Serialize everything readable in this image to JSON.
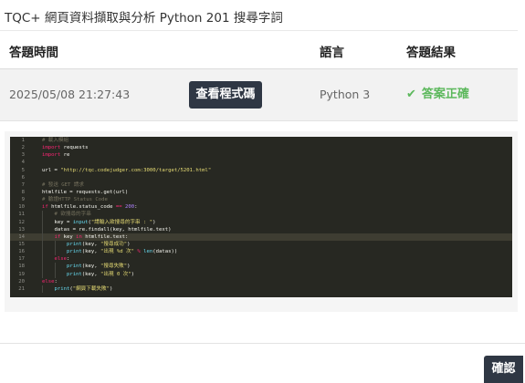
{
  "page": {
    "title": "TQC+ 網頁資料擷取與分析 Python 201 搜尋字詞"
  },
  "table": {
    "headers": [
      "答題時間",
      "語言",
      "答題結果"
    ],
    "row": {
      "time": "2025/05/08 21:27:43",
      "view_button": "查看程式碼",
      "language": "Python 3",
      "result": "答案正確"
    }
  },
  "code": {
    "active_line": 14,
    "lines": [
      [
        {
          "t": "# 載入模組",
          "c": "cm"
        }
      ],
      [
        {
          "t": "import",
          "c": "kw"
        },
        {
          "t": " requests"
        }
      ],
      [
        {
          "t": "import",
          "c": "kw"
        },
        {
          "t": " re"
        }
      ],
      [],
      [
        {
          "t": "url = "
        },
        {
          "t": "\"http://tqc.codejudger.com:3000/target/5201.html\"",
          "c": "st"
        }
      ],
      [],
      [
        {
          "t": "# 發送 GET 請求",
          "c": "cm"
        }
      ],
      [
        {
          "t": "htmlfile = requests.get(url)"
        }
      ],
      [
        {
          "t": "# 驗證HTTP Status Code",
          "c": "cm"
        }
      ],
      [
        {
          "t": "if",
          "c": "kw"
        },
        {
          "t": " htmlfile.status_code "
        },
        {
          "t": "==",
          "c": "kw"
        },
        {
          "t": " "
        },
        {
          "t": "200",
          "c": "nu"
        },
        {
          "t": ":"
        }
      ],
      [
        {
          "t": "    "
        },
        {
          "t": "# 欲搜尋的字串",
          "c": "cm"
        }
      ],
      [
        {
          "t": "    key = "
        },
        {
          "t": "input",
          "c": "bi"
        },
        {
          "t": "("
        },
        {
          "t": "\"請輸入欲搜尋的字串 : \"",
          "c": "st"
        },
        {
          "t": ")"
        }
      ],
      [
        {
          "t": "    datas = re.findall(key, htmlfile.text)"
        }
      ],
      [
        {
          "t": "    "
        },
        {
          "t": "if",
          "c": "kw"
        },
        {
          "t": " key "
        },
        {
          "t": "in",
          "c": "kw"
        },
        {
          "t": " htmlfile.text:"
        }
      ],
      [
        {
          "t": "        "
        },
        {
          "t": "print",
          "c": "bi"
        },
        {
          "t": "(key, "
        },
        {
          "t": "\"搜尋成功\"",
          "c": "st"
        },
        {
          "t": ")"
        }
      ],
      [
        {
          "t": "        "
        },
        {
          "t": "print",
          "c": "bi"
        },
        {
          "t": "(key, "
        },
        {
          "t": "\"出現 %d 次\"",
          "c": "st"
        },
        {
          "t": " "
        },
        {
          "t": "%",
          "c": "kw"
        },
        {
          "t": " "
        },
        {
          "t": "len",
          "c": "bi"
        },
        {
          "t": "(datas))"
        }
      ],
      [
        {
          "t": "    "
        },
        {
          "t": "else",
          "c": "kw"
        },
        {
          "t": ":"
        }
      ],
      [
        {
          "t": "        "
        },
        {
          "t": "print",
          "c": "bi"
        },
        {
          "t": "(key, "
        },
        {
          "t": "\"搜尋失敗\"",
          "c": "st"
        },
        {
          "t": ")"
        }
      ],
      [
        {
          "t": "        "
        },
        {
          "t": "print",
          "c": "bi"
        },
        {
          "t": "(key, "
        },
        {
          "t": "\"出現 0 次\"",
          "c": "st"
        },
        {
          "t": ")"
        }
      ],
      [
        {
          "t": "else",
          "c": "kw"
        },
        {
          "t": ":"
        }
      ],
      [
        {
          "t": "    "
        },
        {
          "t": "print",
          "c": "bi"
        },
        {
          "t": "("
        },
        {
          "t": "\"網頁下載失敗\"",
          "c": "st"
        },
        {
          "t": ")"
        }
      ]
    ]
  },
  "footer": {
    "confirm_button": "確認"
  },
  "colors": {
    "button_bg": "#2f3744",
    "success": "#5cb85c",
    "code_bg": "#272822",
    "row_bg": "#f2f2f2"
  },
  "icons": {
    "result": "check-icon"
  }
}
